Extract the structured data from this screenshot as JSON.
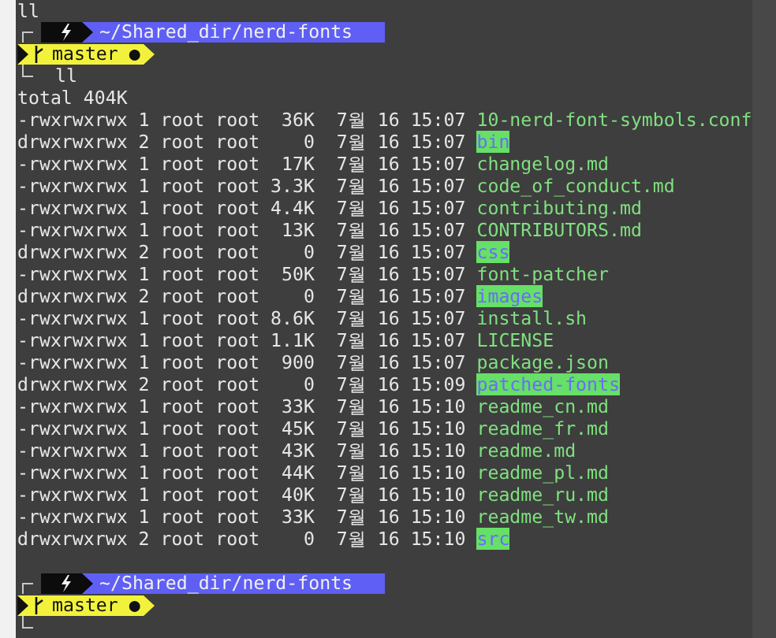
{
  "previous_command": "ll",
  "prompt": {
    "path": "~/Shared_dir/nerd-fonts",
    "branch": "master",
    "status_mark": "●",
    "command": "ll"
  },
  "output": {
    "total": "total 404K",
    "entries": [
      {
        "kind": "file",
        "meta": "-rwxrwxrwx 1 root root  36K  7월 16 15:07",
        "name": "10-nerd-font-symbols.conf"
      },
      {
        "kind": "dir",
        "meta": "drwxrwxrwx 2 root root    0  7월 16 15:07",
        "name": "bin"
      },
      {
        "kind": "file",
        "meta": "-rwxrwxrwx 1 root root  17K  7월 16 15:07",
        "name": "changelog.md"
      },
      {
        "kind": "file",
        "meta": "-rwxrwxrwx 1 root root 3.3K  7월 16 15:07",
        "name": "code_of_conduct.md"
      },
      {
        "kind": "file",
        "meta": "-rwxrwxrwx 1 root root 4.4K  7월 16 15:07",
        "name": "contributing.md"
      },
      {
        "kind": "file",
        "meta": "-rwxrwxrwx 1 root root  13K  7월 16 15:07",
        "name": "CONTRIBUTORS.md"
      },
      {
        "kind": "dir",
        "meta": "drwxrwxrwx 2 root root    0  7월 16 15:07",
        "name": "css"
      },
      {
        "kind": "file",
        "meta": "-rwxrwxrwx 1 root root  50K  7월 16 15:07",
        "name": "font-patcher"
      },
      {
        "kind": "dir",
        "meta": "drwxrwxrwx 2 root root    0  7월 16 15:07",
        "name": "images"
      },
      {
        "kind": "file",
        "meta": "-rwxrwxrwx 1 root root 8.6K  7월 16 15:07",
        "name": "install.sh"
      },
      {
        "kind": "file",
        "meta": "-rwxrwxrwx 1 root root 1.1K  7월 16 15:07",
        "name": "LICENSE"
      },
      {
        "kind": "file",
        "meta": "-rwxrwxrwx 1 root root  900  7월 16 15:07",
        "name": "package.json"
      },
      {
        "kind": "dir",
        "meta": "drwxrwxrwx 2 root root    0  7월 16 15:09",
        "name": "patched-fonts"
      },
      {
        "kind": "file",
        "meta": "-rwxrwxrwx 1 root root  33K  7월 16 15:10",
        "name": "readme_cn.md"
      },
      {
        "kind": "file",
        "meta": "-rwxrwxrwx 1 root root  45K  7월 16 15:10",
        "name": "readme_fr.md"
      },
      {
        "kind": "file",
        "meta": "-rwxrwxrwx 1 root root  43K  7월 16 15:10",
        "name": "readme.md"
      },
      {
        "kind": "file",
        "meta": "-rwxrwxrwx 1 root root  44K  7월 16 15:10",
        "name": "readme_pl.md"
      },
      {
        "kind": "file",
        "meta": "-rwxrwxrwx 1 root root  40K  7월 16 15:10",
        "name": "readme_ru.md"
      },
      {
        "kind": "file",
        "meta": "-rwxrwxrwx 1 root root  33K  7월 16 15:10",
        "name": "readme_tw.md"
      },
      {
        "kind": "dir",
        "meta": "drwxrwxrwx 2 root root    0  7월 16 15:10",
        "name": "src"
      }
    ]
  },
  "next_prompt": {
    "path": "~/Shared_dir/nerd-fonts",
    "branch": "master",
    "status_mark": "●"
  }
}
